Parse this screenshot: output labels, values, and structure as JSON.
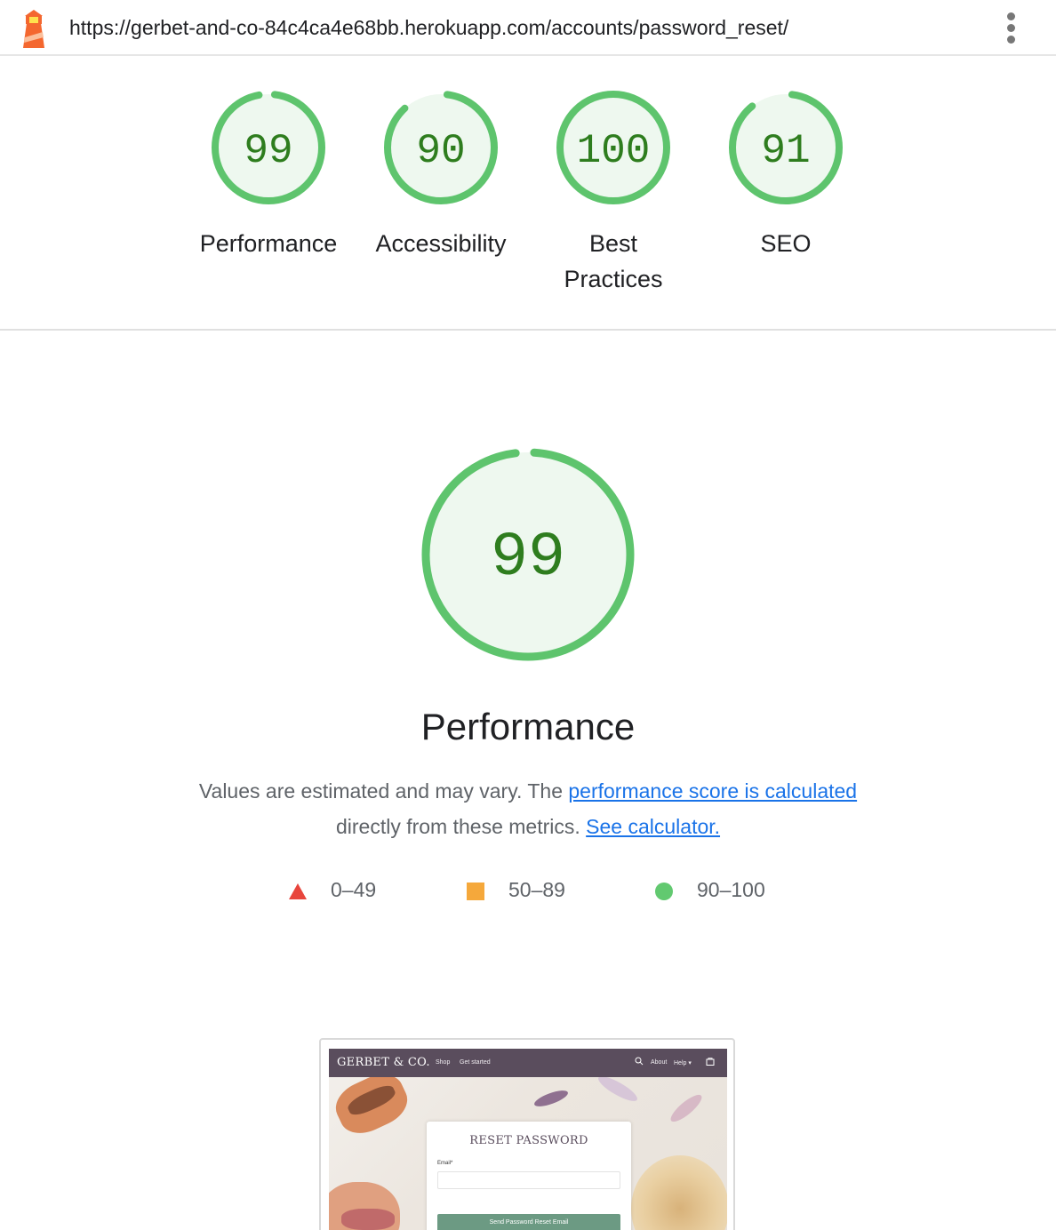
{
  "topbar": {
    "url": "https://gerbet-and-co-84c4ca4e68bb.herokuapp.com/accounts/password_reset/",
    "logo_icon": "lighthouse-icon",
    "menu_icon": "kebab-menu-icon"
  },
  "gauges": [
    {
      "score": "99",
      "value": 0.99,
      "label": "Performance"
    },
    {
      "score": "90",
      "value": 0.9,
      "label": "Accessibility"
    },
    {
      "score": "100",
      "value": 1.0,
      "label_line1": "Best",
      "label_line2": "Practices"
    },
    {
      "score": "91",
      "value": 0.91,
      "label": "SEO"
    }
  ],
  "performance": {
    "score": "99",
    "value": 0.99,
    "title": "Performance",
    "desc_text1": "Values are estimated and may vary. The ",
    "desc_link1": "performance score is calculated",
    "desc_text2": "directly from these metrics. ",
    "desc_link2": "See calculator."
  },
  "legend": [
    {
      "range": "0–49",
      "shape": "triangle",
      "color": "#e8453c"
    },
    {
      "range": "50–89",
      "shape": "square",
      "color": "#f5a83b"
    },
    {
      "range": "90–100",
      "shape": "circle",
      "color": "#62c970"
    }
  ],
  "colors": {
    "pass": "#0cce6b",
    "pass_stroke": "#5ec46d",
    "pass_fill": "#eef8ef",
    "pass_text": "#2e7d1e",
    "link": "#1a73e8"
  },
  "screenshot": {
    "brand": "GERBET & CO.",
    "nav_shop": "Shop",
    "nav_get_started": "Get started",
    "nav_about": "About",
    "nav_help": "Help ▾",
    "card_title": "RESET PASSWORD",
    "email_label": "Email*",
    "button_label": "Send Password Reset Email"
  }
}
